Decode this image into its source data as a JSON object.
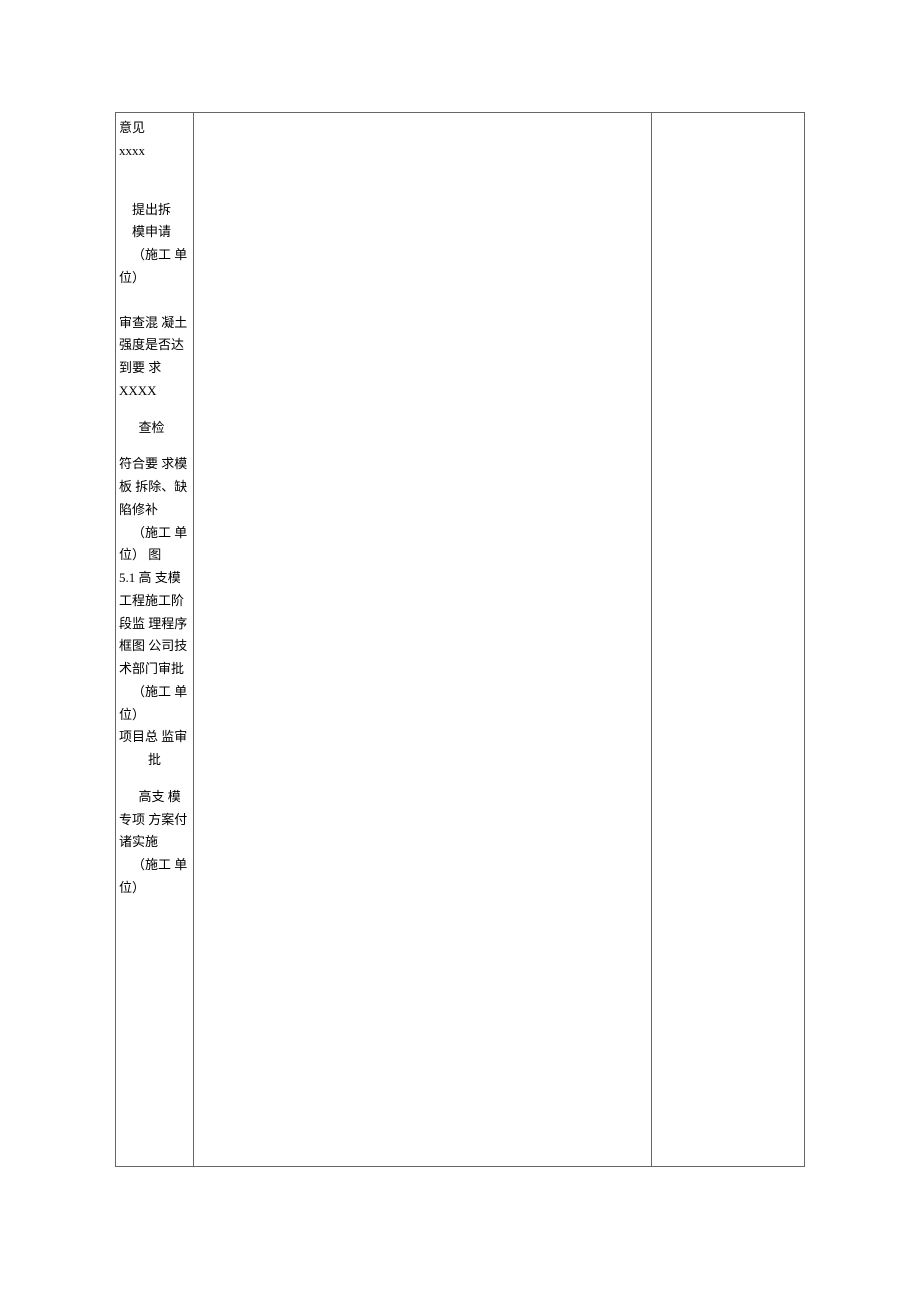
{
  "col_left": {
    "p1_l1": "意见",
    "p1_l2": "xxxx",
    "p2_l1": "提出拆",
    "p2_l2": "模申请",
    "p2_l3": "（施工 单",
    "p2_l4": "位）",
    "p3_l1": "审查混 凝土",
    "p3_l2": "强度是否达",
    "p3_l3": "到要 求",
    "p3_l4": "XXXX",
    "p4_l1": "查检",
    "p5_l1": "符合要 求模",
    "p5_l2": "板 拆除、缺",
    "p5_l3": "陷修补",
    "p5_l4": "（施工 单",
    "p5_l5": "位） 图",
    "p5_l6": "5.1 高 支模",
    "p5_l7": "工程施工阶",
    "p5_l8": "段监 理程序",
    "p5_l9": "框图 公司技",
    "p5_l10": "术部门审批",
    "p5_l11": "（施工 单",
    "p5_l12": "位）",
    "p5_l13": "项目总 监审",
    "p5_l14": "批",
    "p6_l1": "高支 模",
    "p6_l2": "专项 方案付",
    "p6_l3": "诸实施",
    "p6_l4": "（施工 单",
    "p6_l5": "位）"
  }
}
